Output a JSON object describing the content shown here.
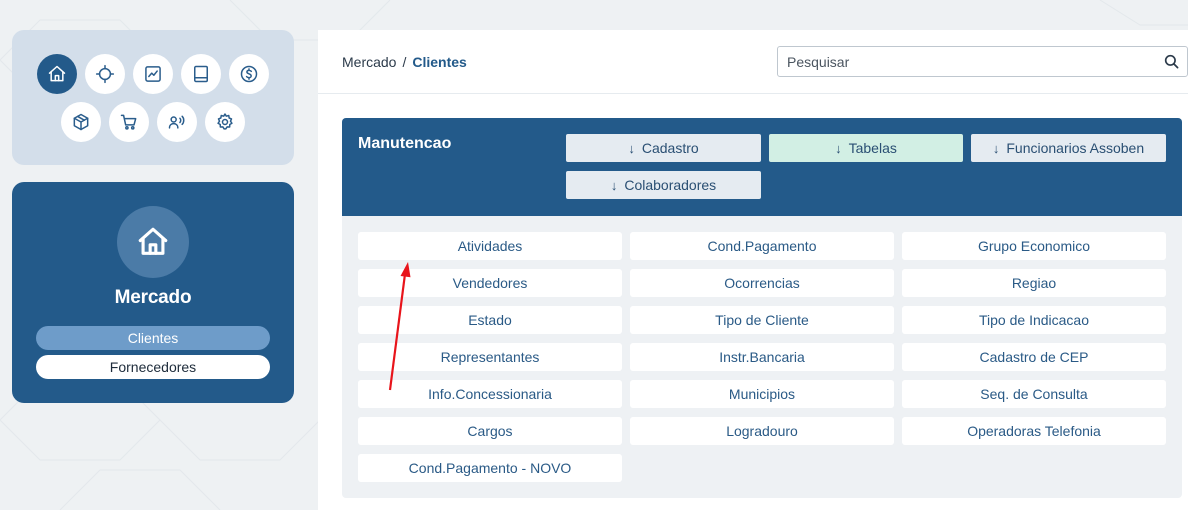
{
  "nav_icons": [
    {
      "icon": "home-icon",
      "active": true
    },
    {
      "icon": "compass-icon",
      "active": false
    },
    {
      "icon": "chart-icon",
      "active": false
    },
    {
      "icon": "book-icon",
      "active": false
    },
    {
      "icon": "dollar-icon",
      "active": false
    },
    {
      "icon": "box-icon",
      "active": false
    },
    {
      "icon": "cart-icon",
      "active": false
    },
    {
      "icon": "contacts-icon",
      "active": false
    },
    {
      "icon": "gear-icon",
      "active": false
    }
  ],
  "module": {
    "icon": "home-icon",
    "title": "Mercado",
    "links": [
      {
        "label": "Clientes",
        "active": true
      },
      {
        "label": "Fornecedores",
        "active": false
      }
    ]
  },
  "breadcrumb": {
    "parent": "Mercado",
    "separator": "/",
    "current": "Clientes"
  },
  "search": {
    "placeholder": "Pesquisar",
    "value": ""
  },
  "card": {
    "title": "Manutencao",
    "tabs": [
      {
        "label": "Cadastro",
        "arrow": "↓",
        "selected": false
      },
      {
        "label": "Tabelas",
        "arrow": "↓",
        "selected": true
      },
      {
        "label": "Funcionarios Assoben",
        "arrow": "↓",
        "selected": false
      },
      {
        "label": "Colaboradores",
        "arrow": "↓",
        "selected": false
      }
    ],
    "items": [
      [
        "Atividades",
        "Cond.Pagamento",
        "Grupo Economico"
      ],
      [
        "Vendedores",
        "Ocorrencias",
        "Regiao"
      ],
      [
        "Estado",
        "Tipo de Cliente",
        "Tipo de Indicacao"
      ],
      [
        "Representantes",
        "Instr.Bancaria",
        "Cadastro de CEP"
      ],
      [
        "Info.Concessionaria",
        "Municipios",
        "Seq. de Consulta"
      ],
      [
        "Cargos",
        "Logradouro",
        "Operadoras Telefonia"
      ],
      [
        "Cond.Pagamento - NOVO"
      ]
    ]
  },
  "colors": {
    "primary": "#235a8a",
    "selected_tab": "#d2efe4",
    "annotation_arrow": "#e8141b"
  }
}
